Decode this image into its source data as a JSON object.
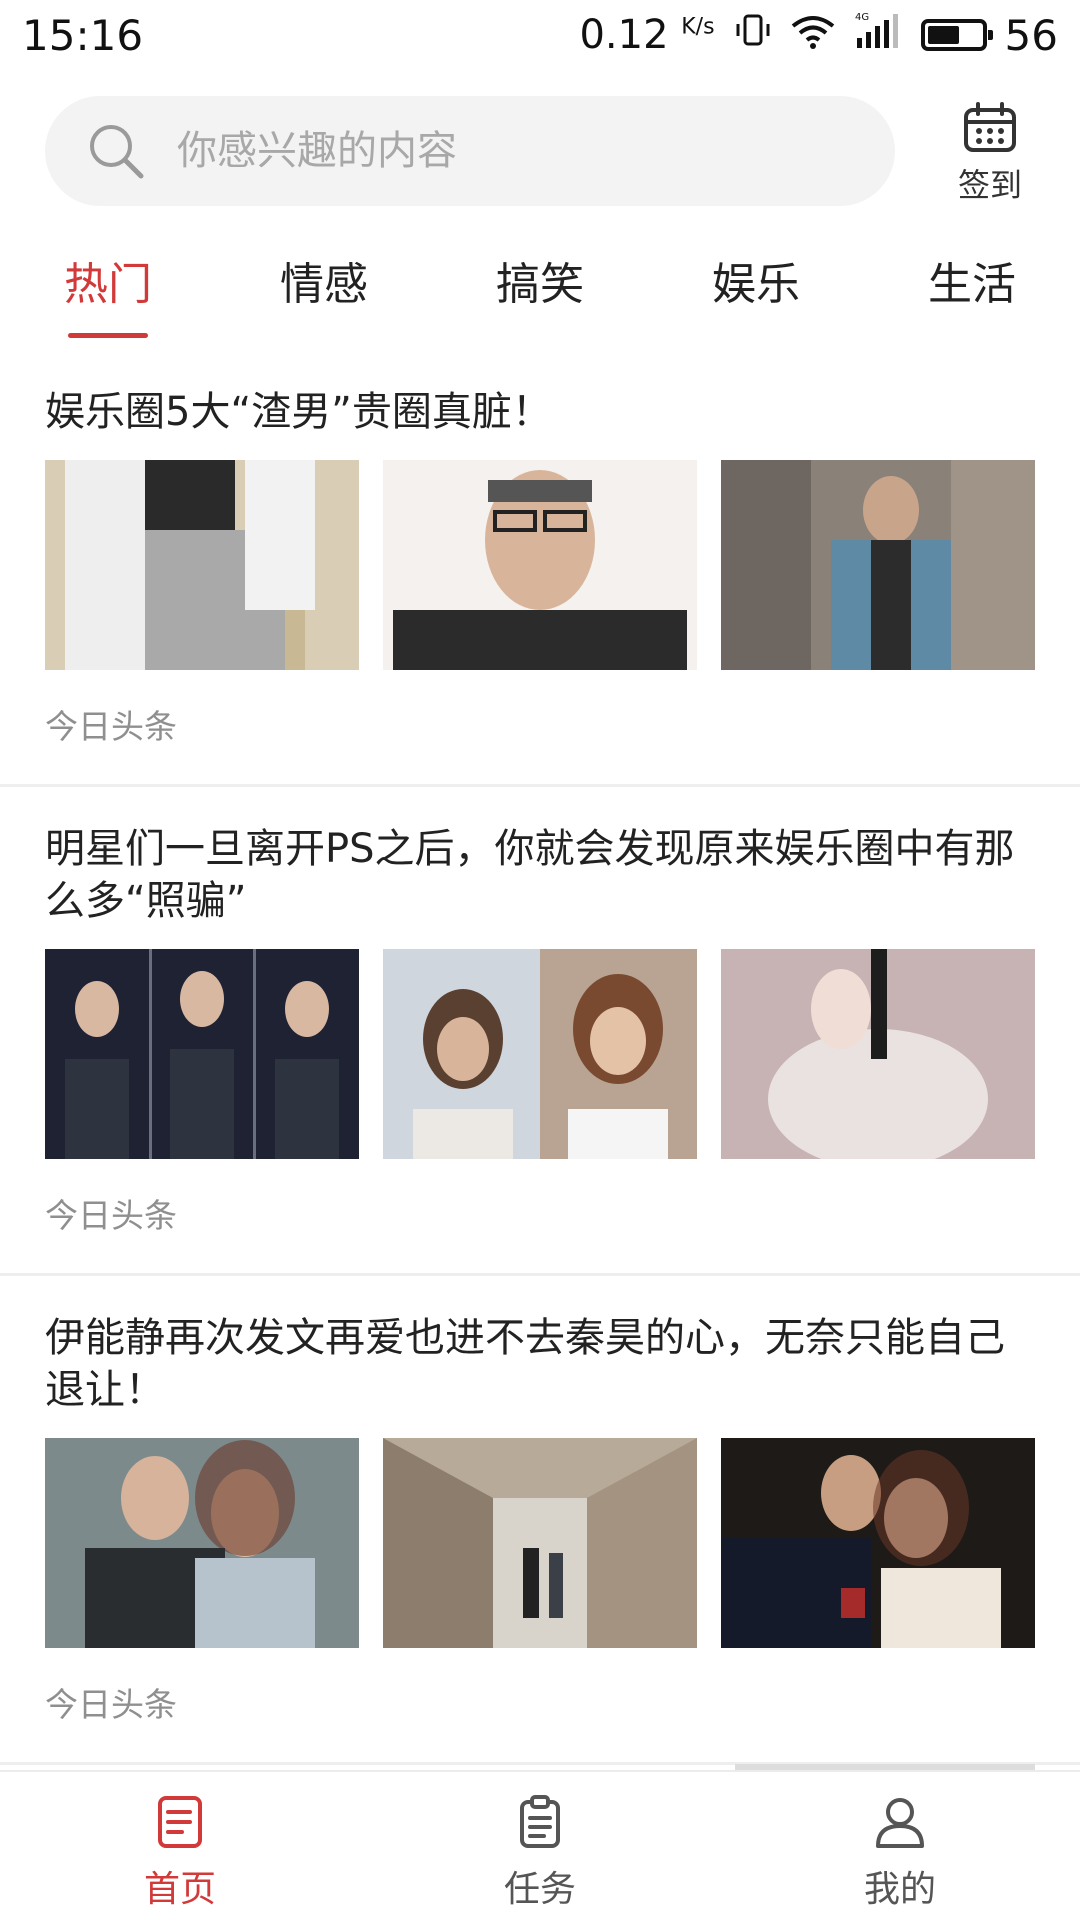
{
  "status_bar": {
    "time": "15:16",
    "speed": "0.12",
    "speed_unit": "K/s",
    "network": "4G",
    "battery": "56"
  },
  "search": {
    "placeholder": "你感兴趣的内容",
    "checkin_label": "签到"
  },
  "tabs": [
    {
      "label": "热门",
      "active": true
    },
    {
      "label": "情感",
      "active": false
    },
    {
      "label": "搞笑",
      "active": false
    },
    {
      "label": "娱乐",
      "active": false
    },
    {
      "label": "生活",
      "active": false
    }
  ],
  "articles": [
    {
      "title": "娱乐圈5大“渣男”贵圈真脏！",
      "source": "今日头条"
    },
    {
      "title": "明星们一旦离开PS之后，你就会发现原来娱乐圈中有那么多“照骗”",
      "source": "今日头条"
    },
    {
      "title": "伊能静再次发文再爱也进不去秦昊的心，无奈只能自己退让！",
      "source": "今日头条"
    }
  ],
  "bottom_nav": [
    {
      "label": "首页",
      "icon": "home-doc-icon",
      "active": true
    },
    {
      "label": "任务",
      "icon": "clipboard-icon",
      "active": false
    },
    {
      "label": "我的",
      "icon": "user-icon",
      "active": false
    }
  ],
  "colors": {
    "accent": "#d23a3a",
    "muted_text": "#8f8f8f",
    "search_bg": "#f3f3f3"
  }
}
